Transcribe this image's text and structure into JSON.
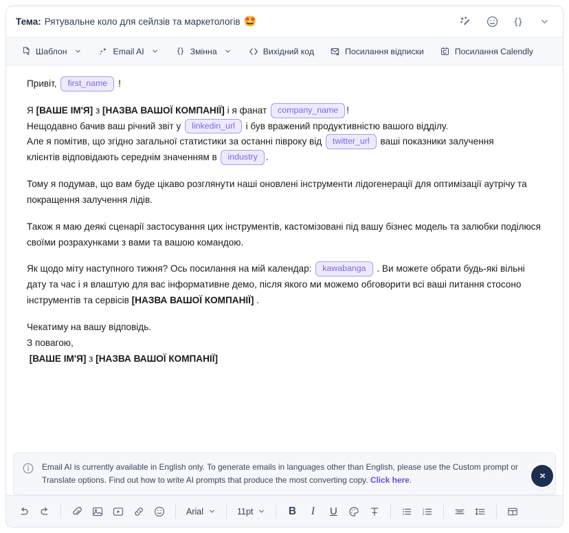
{
  "subject": {
    "label": "Тема:",
    "value": "Рятувальне коло для сейлзів та маркетологів",
    "emoji": "🤩"
  },
  "header_actions": [
    {
      "name": "magic-wand-icon",
      "title": "AI magic"
    },
    {
      "name": "emoji-icon",
      "title": "Emoji"
    },
    {
      "name": "variable-braces-icon",
      "title": "Variable"
    },
    {
      "name": "chevron-down-icon",
      "title": "Collapse"
    }
  ],
  "toolbar": {
    "items": [
      {
        "label": "Шаблон",
        "icon": "template-icon",
        "caret": true
      },
      {
        "label": "Email AI",
        "icon": "sparkle-icon",
        "caret": true
      },
      {
        "label": "Змінна",
        "icon": "braces-icon",
        "caret": true
      },
      {
        "label": "Вихідний код",
        "icon": "code-icon",
        "caret": false
      },
      {
        "label": "Посилання відписки",
        "icon": "unsubscribe-mail-icon",
        "caret": false
      },
      {
        "label": "Посилання Calendly",
        "icon": "calendly-icon",
        "caret": false
      }
    ]
  },
  "body": {
    "greeting_prefix": "Привіт,",
    "greeting_chip": "first_name",
    "greeting_suffix": "!",
    "line_intro_a": "Я ",
    "line_intro_name": "[ВАШЕ ІМ'Я]",
    "line_intro_b": " з ",
    "line_intro_company": "[НАЗВА ВАШОЇ КОМПАНІЇ]",
    "line_intro_c": " і я фанат ",
    "chip_company_name": "company_name",
    "line_intro_d": "!",
    "line2_a": "Нещодавно бачив ваш річний звіт у",
    "chip_linkedin": "linkedin_url",
    "line2_b": "і був вражений продуктивністю вашого відділу.",
    "line3_a": "Але я помітив, що згідно загальної статистики за останні півроку від",
    "chip_twitter": "twitter_url",
    "line3_b": "ваші показники залучення",
    "line4_a": "клієнтів відповідають середнім значенням в",
    "chip_industry": "industry",
    "line4_b": ".",
    "para2": "Тому я подумав, що вам буде цікаво розглянути наші оновлені інструменти лідогенерації для оптимізації аутрічу та покращення залучення лідів.",
    "para3": "Також я маю деякі сценарії застосування цих інструментів, кастомізовані під вашу бізнес модель та залюбки поділюся своїми розрахунками з вами та вашою командою.",
    "para4_a": "Як щодо міту наступного тижня? Ось посилання на мій календар:",
    "chip_kawabanga": "kawabanga",
    "para4_b": ". Ви можете обрати будь-які вільні дату та час і я влаштую для вас інформативне демо, після якого ми можемо обговорити всі ваші питання стосоно інструментів та сервісів",
    "para4_company": "[НАЗВА ВАШОЇ КОМПАНІЇ]",
    "para4_c": ".",
    "closing1": "Чекатиму на вашу відповідь.",
    "closing2": "З повагою,",
    "sign_name": "[ВАШЕ ІМ'Я]",
    "sign_mid": " з ",
    "sign_company": "[НАЗВА ВАШОЇ КОМПАНІЇ]"
  },
  "notice": {
    "text": "Email AI is currently available in English only. To generate emails in languages other than English, please use the Custom prompt or Translate options. Find out how to write AI prompts that produce the most converting copy.",
    "link_label": "Click here",
    "trailing": "."
  },
  "bottom_toolbar": {
    "font_family": "Arial",
    "font_size": "11pt",
    "bold_label": "B",
    "italic_label": "I",
    "underline_label": "U",
    "icons": [
      "undo-icon",
      "redo-icon",
      "attachment-icon",
      "image-icon",
      "video-icon",
      "link-icon",
      "emoji-icon",
      "text-color-icon",
      "clear-format-icon",
      "bullet-list-icon",
      "numbered-list-icon",
      "align-icon",
      "line-height-icon",
      "table-icon"
    ]
  },
  "colors": {
    "chip_border": "#a79bf0",
    "chip_bg": "#eeeafc",
    "chip_text": "#7c66e8",
    "link": "#6b4ce0",
    "fab_bg": "#1d2f4e"
  }
}
